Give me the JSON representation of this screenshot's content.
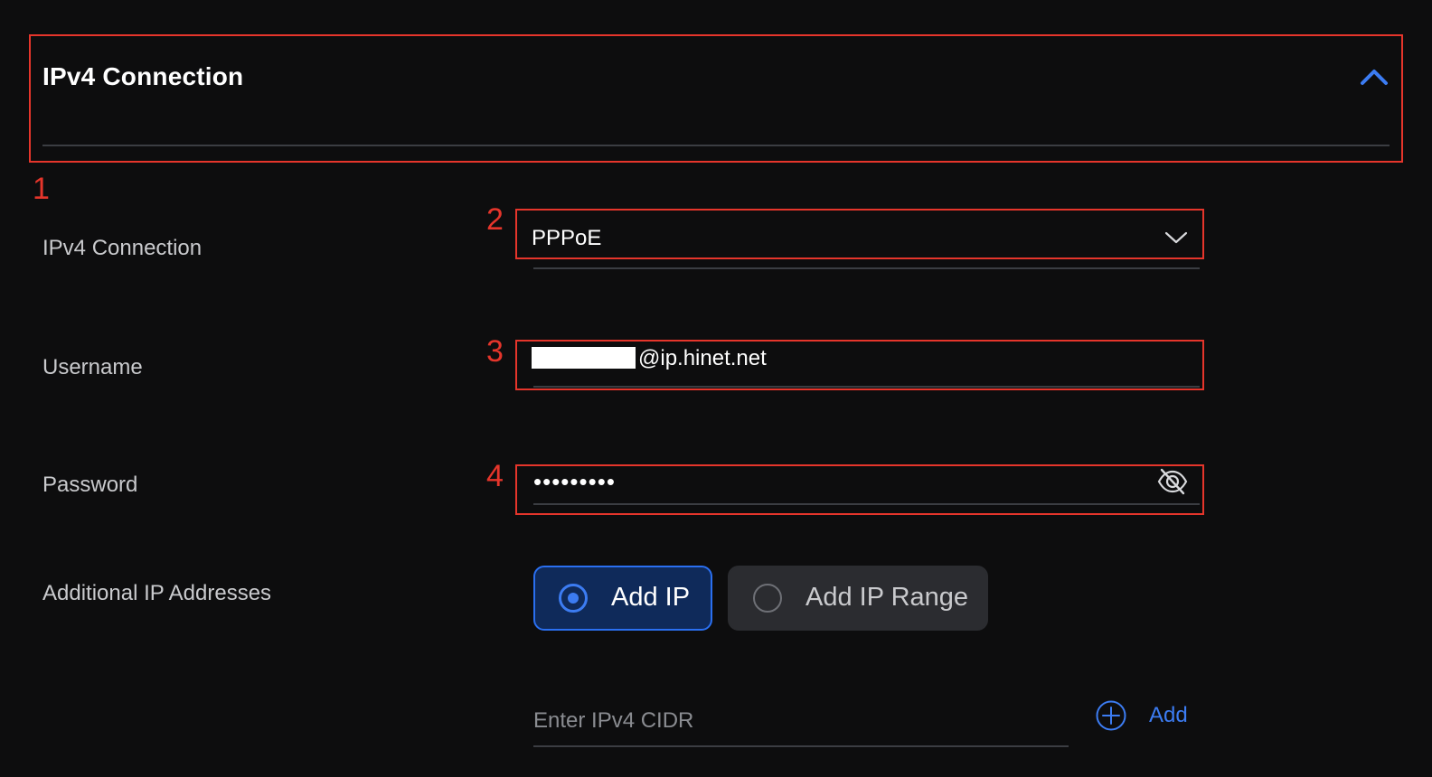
{
  "section": {
    "title": "IPv4 Connection",
    "collapse_icon": "chevron-up-icon"
  },
  "annotations": [
    "1",
    "2",
    "3",
    "4"
  ],
  "form": {
    "connection": {
      "label": "IPv4 Connection",
      "value": "PPPoE",
      "icon": "chevron-down-icon"
    },
    "username": {
      "label": "Username",
      "value": "@ip.hinet.net"
    },
    "password": {
      "label": "Password",
      "masked_value": "•••••••••",
      "toggle_icon": "eye-off-icon"
    },
    "additional_ips": {
      "label": "Additional IP Addresses",
      "options": [
        {
          "label": "Add IP",
          "selected": true
        },
        {
          "label": "Add IP Range",
          "selected": false
        }
      ],
      "cidr_placeholder": "Enter IPv4 CIDR",
      "add_label": "Add",
      "add_icon": "plus-circle-icon"
    }
  },
  "colors": {
    "background": "#0d0d0e",
    "accent": "#3c7cf2",
    "annotation": "#e5352b",
    "label": "#c9cacd",
    "divider": "#3b3d42"
  }
}
